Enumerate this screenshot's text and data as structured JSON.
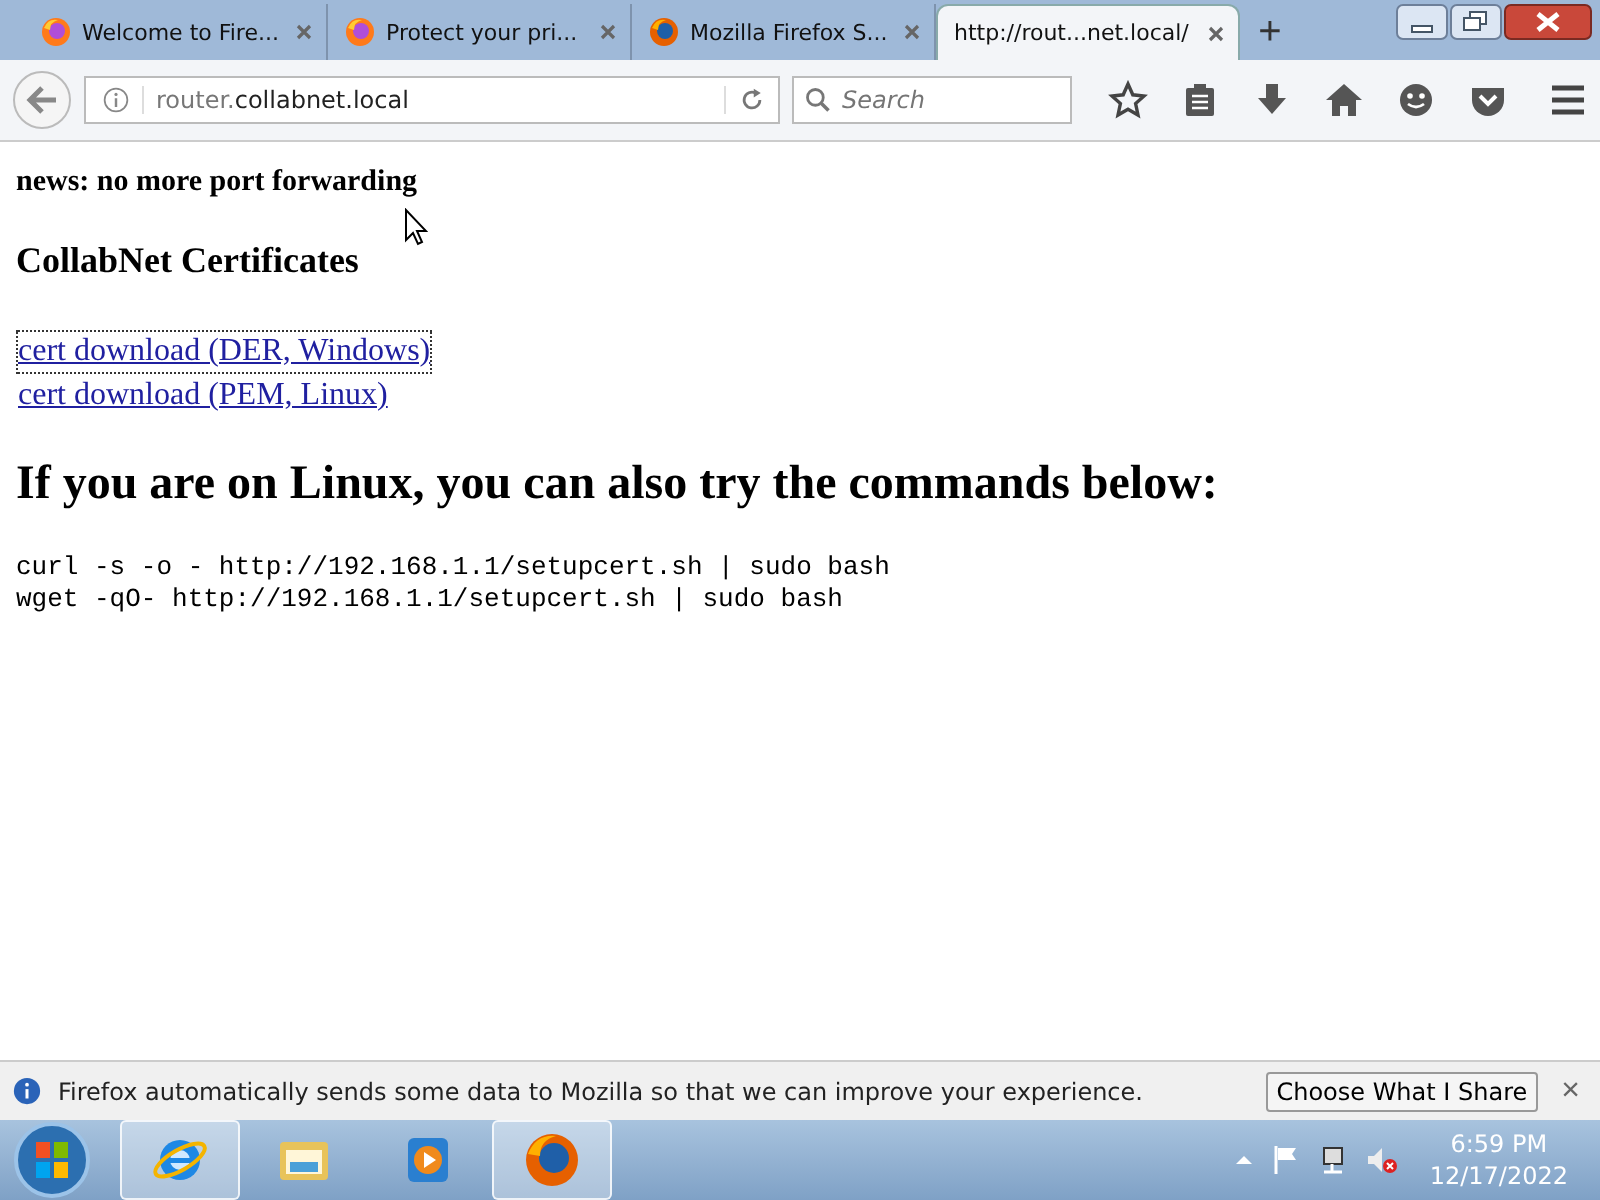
{
  "tabs": [
    {
      "title": "Welcome to Fire...",
      "selected": false,
      "kind": "firefox"
    },
    {
      "title": "Protect your pri...",
      "selected": false,
      "kind": "firefox"
    },
    {
      "title": "Mozilla Firefox S...",
      "selected": false,
      "kind": "globe"
    },
    {
      "title": "http://rout...net.local/",
      "selected": true,
      "kind": "page"
    }
  ],
  "new_tab": "+",
  "url": {
    "subdomain": "router.",
    "domain": "collabnet.local"
  },
  "search": {
    "placeholder": "Search"
  },
  "page": {
    "news": "news: no more port forwarding",
    "heading": "CollabNet Certificates",
    "links": [
      {
        "text": "cert download (DER, Windows)",
        "focused": true
      },
      {
        "text": "cert download (PEM, Linux)",
        "focused": false
      }
    ],
    "subheading": "If you are on Linux, you can also try the commands below:",
    "commands": [
      "curl -s -o - http://192.168.1.1/setupcert.sh | sudo bash",
      "wget -qO- http://192.168.1.1/setupcert.sh | sudo bash"
    ]
  },
  "notification": {
    "message": "Firefox automatically sends some data to Mozilla so that we can improve your experience.",
    "button": "Choose What I Share",
    "close": "×"
  },
  "taskbar": {
    "apps": [
      {
        "kind": "ie",
        "active": true
      },
      {
        "kind": "folder",
        "active": false
      },
      {
        "kind": "media",
        "active": false
      },
      {
        "kind": "firefox",
        "active": true
      }
    ],
    "time": "6:59 PM",
    "date": "12/17/2022"
  }
}
